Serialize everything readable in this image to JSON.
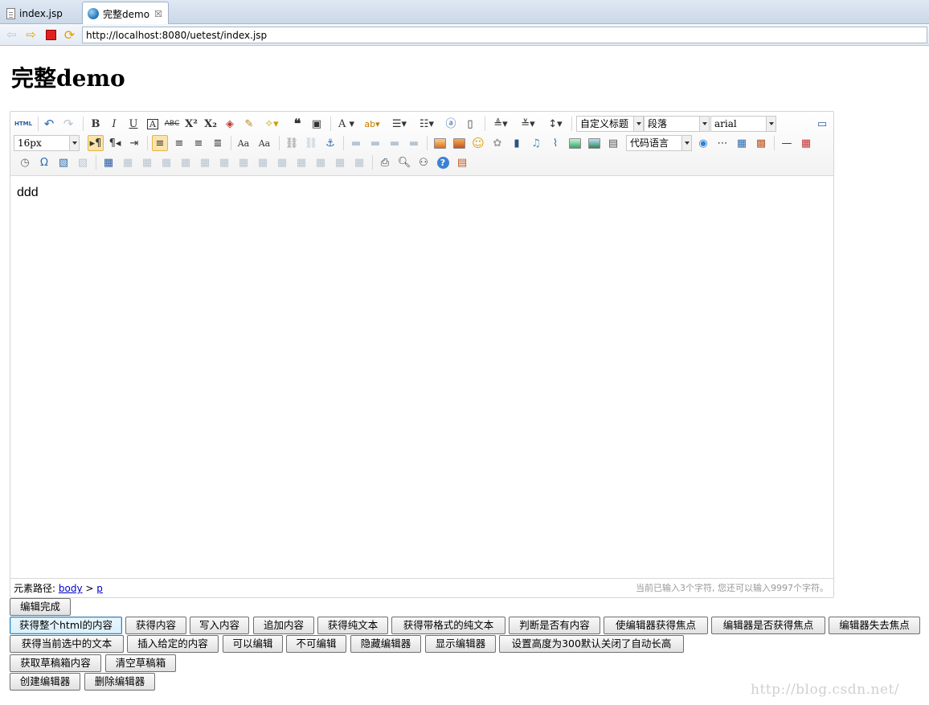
{
  "browser": {
    "tabs": [
      {
        "label": "index.jsp",
        "icon": "file-icon",
        "active": false
      },
      {
        "label": "完整demo",
        "icon": "globe-icon",
        "active": true
      }
    ],
    "tab_close": "☒",
    "url": "http://localhost:8080/uetest/index.jsp"
  },
  "page": {
    "title": "完整demo"
  },
  "editor": {
    "toolbar": {
      "html_label": "HTML",
      "heading_style": "自定义标题",
      "paragraph": "段落",
      "font_family": "arial",
      "font_size": "16px",
      "code_language": "代码语言"
    },
    "content": "ddd",
    "status": {
      "path_label": "元素路径:",
      "path_body": "body",
      "path_sep": ">",
      "path_p": "p",
      "word_count": "当前已输入3个字符, 您还可以输入9997个字符。"
    }
  },
  "buttons": {
    "row1": [
      "编辑完成"
    ],
    "row2": [
      "获得整个html的内容",
      "获得内容",
      "写入内容",
      "追加内容",
      "获得纯文本",
      "获得带格式的纯文本",
      "判断是否有内容",
      "使编辑器获得焦点",
      "编辑器是否获得焦点",
      "编辑器失去焦点"
    ],
    "row3": [
      "获得当前选中的文本",
      "插入给定的内容",
      "可以编辑",
      "不可编辑",
      "隐藏编辑器",
      "显示编辑器",
      "设置高度为300默认关闭了自动长高"
    ],
    "row4": [
      "获取草稿箱内容",
      "清空草稿箱"
    ],
    "row5": [
      "创建编辑器",
      "删除编辑器"
    ]
  },
  "watermark": "http://blog.csdn.net/"
}
